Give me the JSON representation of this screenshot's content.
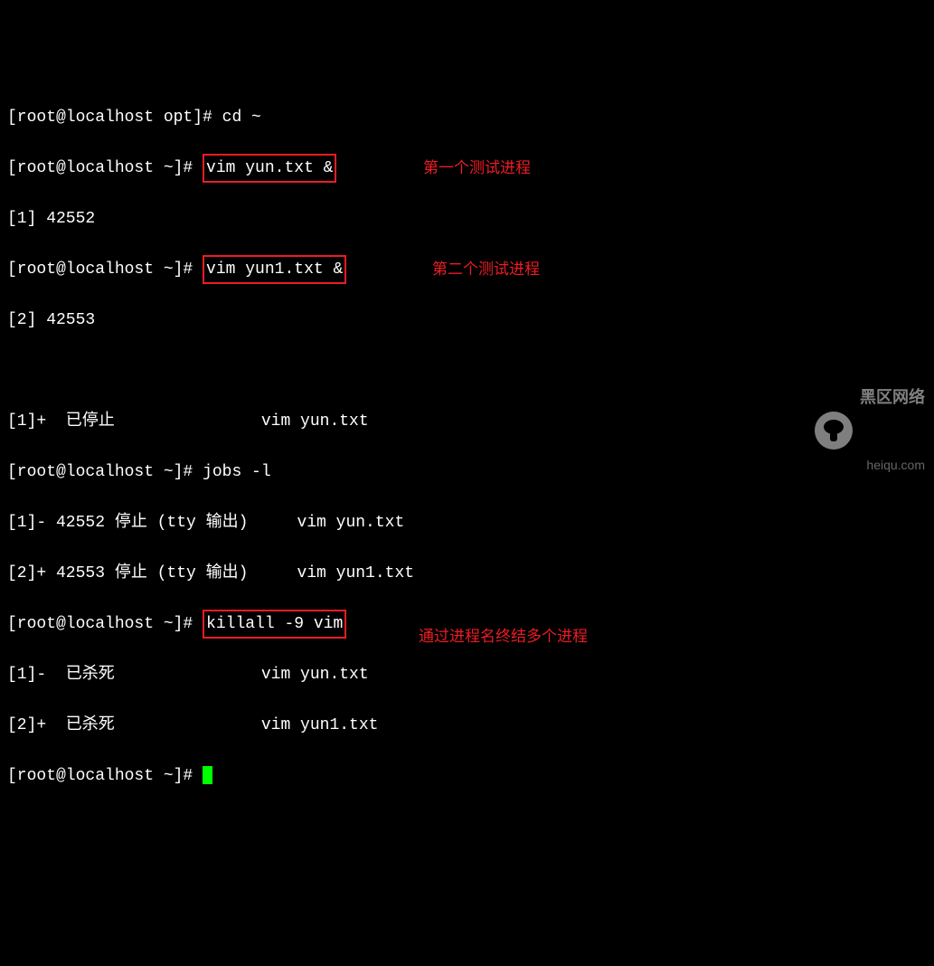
{
  "lines": {
    "l1_prompt": "[root@localhost opt]# ",
    "l1_cmd": "cd ~",
    "l2_prompt": "[root@localhost ~]# ",
    "l2_cmd": "vim yun.txt &",
    "l3": "[1] 42552",
    "l4_prompt": "[root@localhost ~]# ",
    "l4_cmd": "vim yun1.txt &",
    "l5": "[2] 42553",
    "l6": "",
    "l7": "[1]+  已停止               vim yun.txt",
    "l8_prompt": "[root@localhost ~]# ",
    "l8_cmd": "jobs -l",
    "l9": "[1]- 42552 停止 (tty 输出)     vim yun.txt",
    "l10": "[2]+ 42553 停止 (tty 输出)     vim yun1.txt",
    "l11_prompt": "[root@localhost ~]# ",
    "l11_cmd": "killall -9 vim",
    "l12": "[1]-  已杀死               vim yun.txt",
    "l13": "[2]+  已杀死               vim yun1.txt",
    "l14_prompt": "[root@localhost ~]# "
  },
  "annotations": {
    "a1": "第一个测试进程",
    "a2": "第二个测试进程",
    "a3": "通过进程名终结多个进程"
  },
  "watermark": {
    "title": "黑区网络",
    "url": "heiqu.com"
  }
}
